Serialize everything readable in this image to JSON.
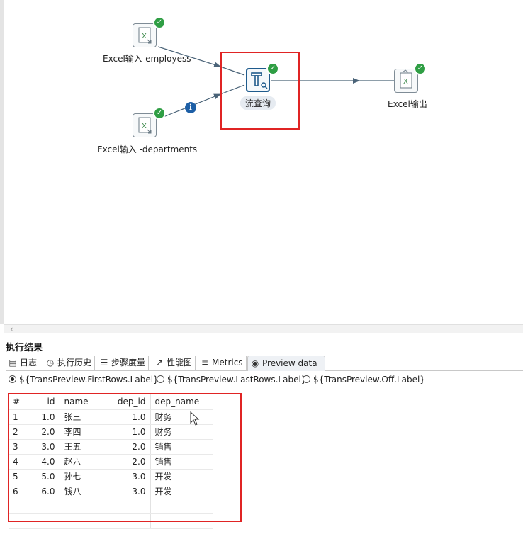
{
  "canvas": {
    "steps": {
      "employees": {
        "label": "Excel输入-employess",
        "icon": "excel-input-icon",
        "status": "success"
      },
      "departments": {
        "label": "Excel输入 -departments",
        "icon": "excel-input-icon",
        "status": "success"
      },
      "lookup": {
        "label": "流查询",
        "icon": "stream-lookup-icon",
        "status": "success"
      },
      "output": {
        "label": "Excel输出",
        "icon": "excel-output-icon",
        "status": "success"
      }
    },
    "hop_info_glyph": "i",
    "check_glyph": "✓"
  },
  "results": {
    "title": "执行结果",
    "tabs": [
      {
        "label": "日志",
        "icon": "log-icon"
      },
      {
        "label": "执行历史",
        "icon": "history-icon"
      },
      {
        "label": "步骤度量",
        "icon": "step-metrics-icon"
      },
      {
        "label": "性能图",
        "icon": "performance-chart-icon"
      },
      {
        "label": "Metrics",
        "icon": "metrics-icon"
      },
      {
        "label": "Preview data",
        "icon": "eye-icon",
        "active": true
      }
    ],
    "radios": [
      {
        "label": "${TransPreview.FirstRows.Label}",
        "checked": true
      },
      {
        "label": "${TransPreview.LastRows.Label}",
        "checked": false
      },
      {
        "label": "${TransPreview.Off.Label}",
        "checked": false
      }
    ],
    "table": {
      "columns": [
        "#",
        "id",
        "name",
        "dep_id",
        "dep_name"
      ],
      "rows": [
        [
          "1",
          "1.0",
          "张三",
          "1.0",
          "财务"
        ],
        [
          "2",
          "2.0",
          "李四",
          "1.0",
          "财务"
        ],
        [
          "3",
          "3.0",
          "王五",
          "2.0",
          "销售"
        ],
        [
          "4",
          "4.0",
          "赵六",
          "2.0",
          "销售"
        ],
        [
          "5",
          "5.0",
          "孙七",
          "3.0",
          "开发"
        ],
        [
          "6",
          "6.0",
          "钱八",
          "3.0",
          "开发"
        ]
      ]
    }
  },
  "colors": {
    "success": "#2f9e44",
    "info": "#1d5fa6",
    "highlight": "#e02424",
    "hop": "#4a6378"
  }
}
